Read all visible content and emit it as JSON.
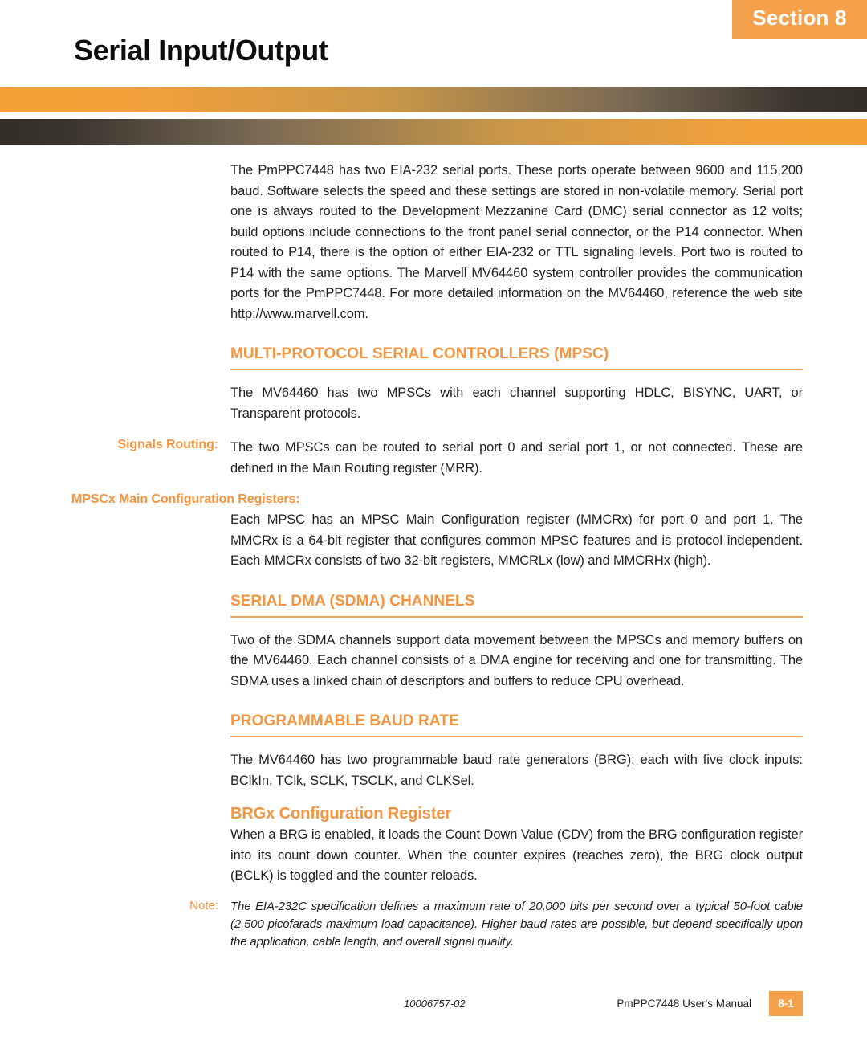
{
  "header": {
    "section_badge": "Section 8",
    "title": "Serial Input/Output"
  },
  "body": {
    "intro_paragraph": "The PmPPC7448 has two EIA-232 serial ports. These ports operate between 9600 and 115,200 baud. Software selects the speed and these settings are stored in non-volatile memory. Serial port one is always routed to the Development Mezzanine Card (DMC) serial connector as 12 volts; build options include connections to the front panel serial connector, or the P14 connector. When routed to P14, there is the option of either EIA-232 or TTL signaling levels. Port two is routed to P14 with the same options. The Marvell MV64460 system controller provides the communication ports for the PmPPC7448. For more detailed information on the MV64460, reference the web site http://www.marvell.com.",
    "sections": [
      {
        "heading": "MULTI-PROTOCOL SERIAL CONTROLLERS (MPSC)",
        "paragraph": "The MV64460 has two MPSCs with each channel supporting HDLC, BISYNC, UART, or Transparent protocols."
      },
      {
        "heading": "SERIAL DMA (SDMA) CHANNELS",
        "paragraph": "Two of the SDMA channels support data movement between the MPSCs and memory buffers on the MV64460. Each channel consists of a DMA engine for receiving and one for transmitting. The SDMA uses a linked chain of descriptors and buffers to reduce CPU overhead."
      },
      {
        "heading": "PROGRAMMABLE BAUD RATE",
        "paragraph": "The MV64460 has two programmable baud rate generators (BRG); each with five clock inputs: BClkIn, TClk, SCLK, TSCLK, and CLKSel."
      }
    ],
    "signals_routing": {
      "label": "Signals Routing:",
      "paragraph": "The two MPSCs can be routed to serial port 0 and serial port 1, or not connected. These are defined in the Main Routing register (MRR)."
    },
    "mpscx_registers": {
      "label": "MPSCx Main Configuration Registers:",
      "paragraph": "Each MPSC has an MPSC Main Configuration register (MMCRx) for port 0 and port 1. The MMCRx is a 64-bit register that configures common MPSC features and is protocol independent. Each MMCRx consists of two 32-bit registers, MMCRLx (low) and MMCRHx (high)."
    },
    "brgx": {
      "sub_heading": "BRGx Configuration Register",
      "paragraph": "When a BRG is enabled, it loads the Count Down Value (CDV) from the BRG configuration register into its count down counter. When the counter expires (reaches zero), the BRG clock output (BCLK) is toggled and the counter reloads."
    },
    "note": {
      "label": "Note:",
      "text": "The EIA-232C specification defines a maximum rate of 20,000 bits per second over a typical 50-foot cable (2,500 picofarads maximum load capacitance). Higher baud rates are possible, but depend specifically upon the application, cable length, and overall signal quality."
    }
  },
  "footer": {
    "doc_id": "10006757-02",
    "manual_title": "PmPPC7448 User's Manual",
    "page_number": "8-1"
  },
  "colors": {
    "accent_orange": "#F4943E",
    "badge_orange": "#F5A04A",
    "bar_dark": "#332e28",
    "text": "#231f20"
  }
}
